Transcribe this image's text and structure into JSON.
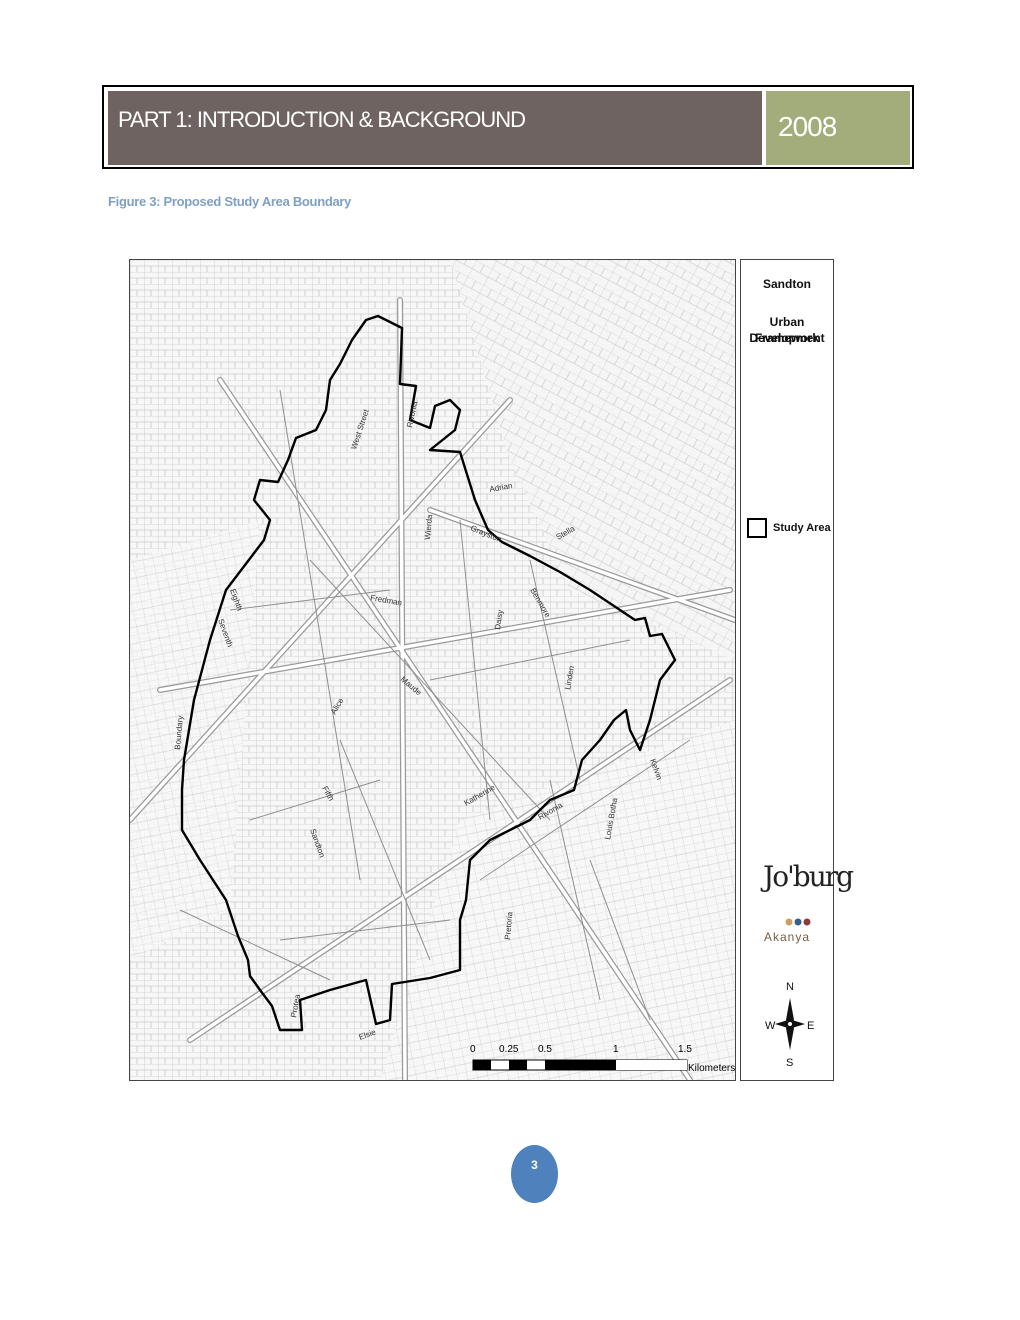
{
  "header": {
    "title": "PART 1: INTRODUCTION & BACKGROUND",
    "year": "2008",
    "colors": {
      "title_bg": "#6e6360",
      "year_bg": "#a3ad7c"
    }
  },
  "figure": {
    "caption": "Figure 3: Proposed Study Area Boundary"
  },
  "legend": {
    "title_line1": "Sandton",
    "title_line2": "Urban Development",
    "title_line3": "Framework",
    "key_label": "Study Area",
    "logo_joburg": "Jo'burg",
    "logo_akanya": "Akanya",
    "compass": {
      "n": "N",
      "s": "S",
      "e": "E",
      "w": "W"
    }
  },
  "scale_bar": {
    "labels": [
      "0",
      "0.25",
      "0.5",
      "1",
      "1.5"
    ],
    "unit": "Kilometers"
  },
  "streets": {
    "s1": "West Street",
    "s2": "Rivonia",
    "s3": "Grayston",
    "s4": "Fredman",
    "s5": "Katherine",
    "s6": "Maude",
    "s7": "Alice",
    "s8": "Fifth",
    "s9": "Sandton",
    "s10": "Daisy",
    "s11": "Wierda",
    "s12": "Benmore",
    "s13": "Linden",
    "s14": "Pretoria",
    "s15": "Rivonia",
    "s16": "Louis Botha",
    "s17": "Eighth",
    "s18": "Seventh",
    "s19": "Boundary",
    "s20": "Protea",
    "s21": "Kelvin",
    "s22": "Adrian",
    "s23": "Stella",
    "s24": "Elsie"
  },
  "page": {
    "number": "3"
  }
}
